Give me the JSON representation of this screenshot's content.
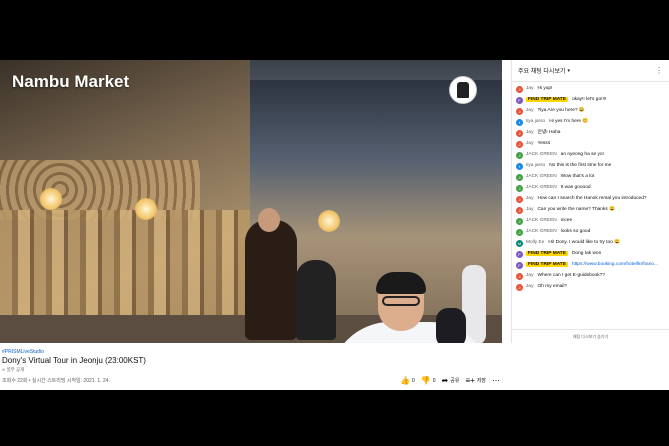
{
  "video": {
    "overlay_title": "Nambu Market"
  },
  "meta": {
    "hashtag": "#PRISMLiveStudio",
    "title": "Dony's Virtual Tour in Jeonju (23:00KST)",
    "channel": "∞ 일부 공개",
    "info": "조회수 22회 • 실시간 스트리밍 시작일: 2021. 1. 24.",
    "like_count": "0",
    "dislike_count": "0",
    "share_label": "공유",
    "save_label": "저장",
    "more": "⋯"
  },
  "chat": {
    "header": "주요 채팅 다시보기",
    "footer": "채팅 다시보기 숨기기",
    "messages": [
      {
        "initial": "J",
        "color": "#e8543a",
        "author": "Jay",
        "badge": false,
        "text": "Hi yup!"
      },
      {
        "initial": "F",
        "color": "#7e57c2",
        "author": "FIND TRIP MATE",
        "badge": true,
        "text": "okay!! let's go!!!!"
      },
      {
        "initial": "J",
        "color": "#e8543a",
        "author": "Jay",
        "badge": false,
        "text": "Tiya Are you here? 😀"
      },
      {
        "initial": "t",
        "color": "#1e88e5",
        "author": "tiya jarso",
        "badge": false,
        "text": "Hi yes I'm here 😊"
      },
      {
        "initial": "J",
        "color": "#e8543a",
        "author": "Jay",
        "badge": false,
        "text": "안녕! Haha"
      },
      {
        "initial": "J",
        "color": "#e8543a",
        "author": "Jay",
        "badge": false,
        "text": "Yesss"
      },
      {
        "initial": "J",
        "color": "#43a047",
        "author": "JACK GREEN",
        "badge": false,
        "text": "an nyeong ha se yo!"
      },
      {
        "initial": "t",
        "color": "#1e88e5",
        "author": "tiya jarso",
        "badge": false,
        "text": "No this is the first time for me"
      },
      {
        "initial": "J",
        "color": "#43a047",
        "author": "JACK GREEN",
        "badge": false,
        "text": "Wow that's a lot"
      },
      {
        "initial": "J",
        "color": "#43a047",
        "author": "JACK GREEN",
        "badge": false,
        "text": "It was gooood"
      },
      {
        "initial": "J",
        "color": "#e8543a",
        "author": "Jay",
        "badge": false,
        "text": "How can I search the Hanok rental you introduced?"
      },
      {
        "initial": "J",
        "color": "#e8543a",
        "author": "Jay",
        "badge": false,
        "text": "Can you write the name? Thanks 😀"
      },
      {
        "initial": "J",
        "color": "#43a047",
        "author": "JACK GREEN",
        "badge": false,
        "text": "nicee"
      },
      {
        "initial": "J",
        "color": "#43a047",
        "author": "JACK GREEN",
        "badge": false,
        "text": "looks so good"
      },
      {
        "initial": "M",
        "color": "#00897b",
        "author": "Molly Ee",
        "badge": false,
        "text": "Hi! Dony. I would like to try too 😀"
      },
      {
        "initial": "F",
        "color": "#7e57c2",
        "author": "FIND TRIP MATE",
        "badge": true,
        "text": "Dong tak won"
      },
      {
        "initial": "F",
        "color": "#7e57c2",
        "author": "FIND TRIP MATE",
        "badge": true,
        "text": "https://www.booking.com/hotel/kr/hano...",
        "link": true
      },
      {
        "initial": "J",
        "color": "#e8543a",
        "author": "Jay",
        "badge": false,
        "text": "Where can I get E-guidebook??"
      },
      {
        "initial": "J",
        "color": "#e8543a",
        "author": "Jay",
        "badge": false,
        "text": "Oh my email?"
      }
    ]
  }
}
